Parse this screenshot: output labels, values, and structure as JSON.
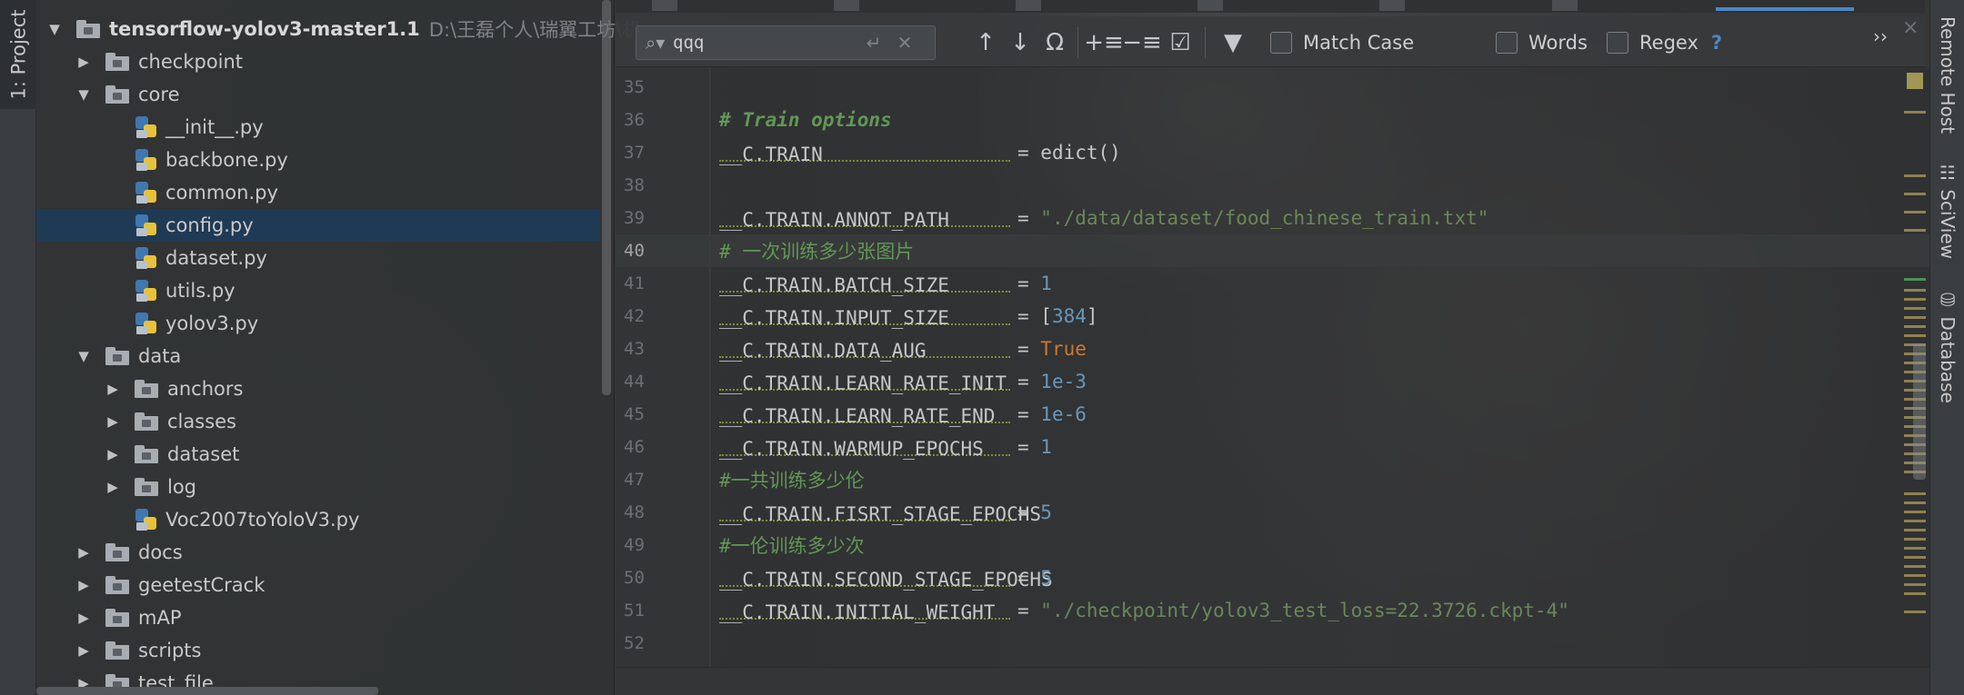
{
  "left_panel": {
    "tab_label": "1: Project"
  },
  "project_tree": {
    "root": {
      "label": "tensorflow-yolov3-master1.1",
      "path": "D:\\王磊个人\\瑞翼工坊\\机"
    },
    "items": [
      {
        "label": "checkpoint",
        "kind": "folder",
        "expanded": false
      },
      {
        "label": "core",
        "kind": "folder",
        "expanded": true
      },
      {
        "label": "__init__.py",
        "kind": "file"
      },
      {
        "label": "backbone.py",
        "kind": "file"
      },
      {
        "label": "common.py",
        "kind": "file"
      },
      {
        "label": "config.py",
        "kind": "file",
        "selected": true
      },
      {
        "label": "dataset.py",
        "kind": "file"
      },
      {
        "label": "utils.py",
        "kind": "file"
      },
      {
        "label": "yolov3.py",
        "kind": "file"
      },
      {
        "label": "data",
        "kind": "folder",
        "expanded": true
      },
      {
        "label": "anchors",
        "kind": "folder",
        "expanded": false
      },
      {
        "label": "classes",
        "kind": "folder",
        "expanded": false
      },
      {
        "label": "dataset",
        "kind": "folder",
        "expanded": false
      },
      {
        "label": "log",
        "kind": "folder",
        "expanded": false
      },
      {
        "label": "Voc2007toYoloV3.py",
        "kind": "file"
      },
      {
        "label": "docs",
        "kind": "folder",
        "expanded": false
      },
      {
        "label": "geetestCrack",
        "kind": "folder",
        "expanded": false
      },
      {
        "label": "mAP",
        "kind": "folder",
        "expanded": false
      },
      {
        "label": "scripts",
        "kind": "folder",
        "expanded": false
      },
      {
        "label": "test_file",
        "kind": "folder",
        "expanded": false
      }
    ]
  },
  "search": {
    "query": "qqq",
    "options": {
      "match_case": "Match Case",
      "words": "Words",
      "regex": "Regex",
      "help": "?"
    },
    "more": "››",
    "close": "×"
  },
  "editor": {
    "lines": [
      {
        "num": "35",
        "parts": []
      },
      {
        "num": "36",
        "parts": [
          {
            "t": "# Train options",
            "c": "cmt"
          }
        ]
      },
      {
        "num": "37",
        "parts": [
          {
            "t": "__C.TRAIN",
            "c": "ident",
            "pad": true
          },
          {
            "t": "= ",
            "c": "eq"
          },
          {
            "t": "edict()",
            "c": "ident"
          }
        ]
      },
      {
        "num": "38",
        "parts": []
      },
      {
        "num": "39",
        "parts": [
          {
            "t": "__C.TRAIN.ANNOT_PATH",
            "c": "ident",
            "pad": true
          },
          {
            "t": "= ",
            "c": "eq"
          },
          {
            "t": "\"./data/dataset/food_chinese_train.txt\"",
            "c": "str"
          }
        ]
      },
      {
        "num": "40",
        "active": true,
        "parts": [
          {
            "t": "# 一次训练多少张图片",
            "c": "cmtcn"
          }
        ]
      },
      {
        "num": "41",
        "parts": [
          {
            "t": "__C.TRAIN.BATCH_SIZE",
            "c": "ident",
            "pad": true
          },
          {
            "t": "= ",
            "c": "eq"
          },
          {
            "t": "1",
            "c": "num"
          }
        ]
      },
      {
        "num": "42",
        "parts": [
          {
            "t": "__C.TRAIN.INPUT_SIZE",
            "c": "ident",
            "pad": true
          },
          {
            "t": "= ",
            "c": "eq"
          },
          {
            "t": "[",
            "c": "ident"
          },
          {
            "t": "384",
            "c": "num"
          },
          {
            "t": "]",
            "c": "ident"
          }
        ]
      },
      {
        "num": "43",
        "parts": [
          {
            "t": "__C.TRAIN.DATA_AUG",
            "c": "ident",
            "pad": true
          },
          {
            "t": "= ",
            "c": "eq"
          },
          {
            "t": "True",
            "c": "kw"
          }
        ]
      },
      {
        "num": "44",
        "parts": [
          {
            "t": "__C.TRAIN.LEARN_RATE_INIT",
            "c": "ident",
            "pad": true
          },
          {
            "t": "= ",
            "c": "eq"
          },
          {
            "t": "1e-3",
            "c": "num"
          }
        ]
      },
      {
        "num": "45",
        "parts": [
          {
            "t": "__C.TRAIN.LEARN_RATE_END",
            "c": "ident",
            "pad": true
          },
          {
            "t": "= ",
            "c": "eq"
          },
          {
            "t": "1e-6",
            "c": "num"
          }
        ]
      },
      {
        "num": "46",
        "parts": [
          {
            "t": "__C.TRAIN.WARMUP_EPOCHS",
            "c": "ident",
            "pad": true
          },
          {
            "t": "= ",
            "c": "eq"
          },
          {
            "t": "1",
            "c": "num"
          }
        ]
      },
      {
        "num": "47",
        "parts": [
          {
            "t": "#一共训练多少伦",
            "c": "cmtcn"
          }
        ]
      },
      {
        "num": "48",
        "parts": [
          {
            "t": "__C.TRAIN.FISRT_STAGE_EPOCHS",
            "c": "ident",
            "pad": true
          },
          {
            "t": "= ",
            "c": "eq"
          },
          {
            "t": "5",
            "c": "num"
          }
        ]
      },
      {
        "num": "49",
        "parts": [
          {
            "t": "#一伦训练多少次",
            "c": "cmtcn"
          }
        ]
      },
      {
        "num": "50",
        "parts": [
          {
            "t": "__C.TRAIN.SECOND_STAGE_EPOCHS",
            "c": "ident",
            "pad": true
          },
          {
            "t": "= ",
            "c": "eq"
          },
          {
            "t": "5",
            "c": "num"
          }
        ]
      },
      {
        "num": "51",
        "parts": [
          {
            "t": "__C.TRAIN.INITIAL_WEIGHT",
            "c": "ident",
            "pad": true
          },
          {
            "t": "= ",
            "c": "eq"
          },
          {
            "t": "\"./checkpoint/yolov3_test_loss=22.3726.ckpt-4\"",
            "c": "str"
          }
        ]
      },
      {
        "num": "52",
        "parts": []
      }
    ]
  },
  "right_panel": {
    "tabs": [
      "Remote Host",
      "SciView",
      "Database"
    ]
  },
  "colors": {
    "selection": "#1f3a55",
    "string": "#6a8759",
    "number": "#6897bb",
    "keyword": "#cc7832",
    "comment": "#629755"
  }
}
